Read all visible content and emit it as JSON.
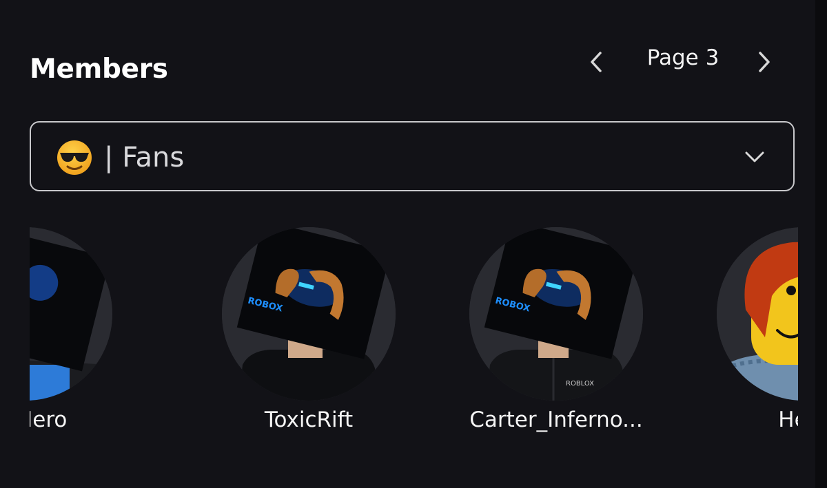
{
  "members_section": {
    "title": "Members",
    "pager": {
      "label": "Page 3",
      "prev_icon": "chevron-left-icon",
      "next_icon": "chevron-right-icon"
    },
    "role_dropdown": {
      "emoji": "sunglasses-face-emoji",
      "selected": "| Fans",
      "caret_icon": "chevron-down-icon"
    },
    "members": [
      {
        "display_name": "er_Hero",
        "avatar": "blue-glow-box-head"
      },
      {
        "display_name": "ToxicRift",
        "avatar": "blue-glow-box-head-brown-hair"
      },
      {
        "display_name": "Carter_Inferno...",
        "avatar": "blue-glow-box-head-brown-hair-jacket"
      },
      {
        "display_name": "Hero",
        "avatar": "red-hair-classic-face"
      }
    ]
  },
  "colors": {
    "background": "#121217",
    "avatar_bg": "#2a2b31",
    "border": "#c9c9cc",
    "text": "#ffffff",
    "glow_blue": "#1e6fff"
  }
}
